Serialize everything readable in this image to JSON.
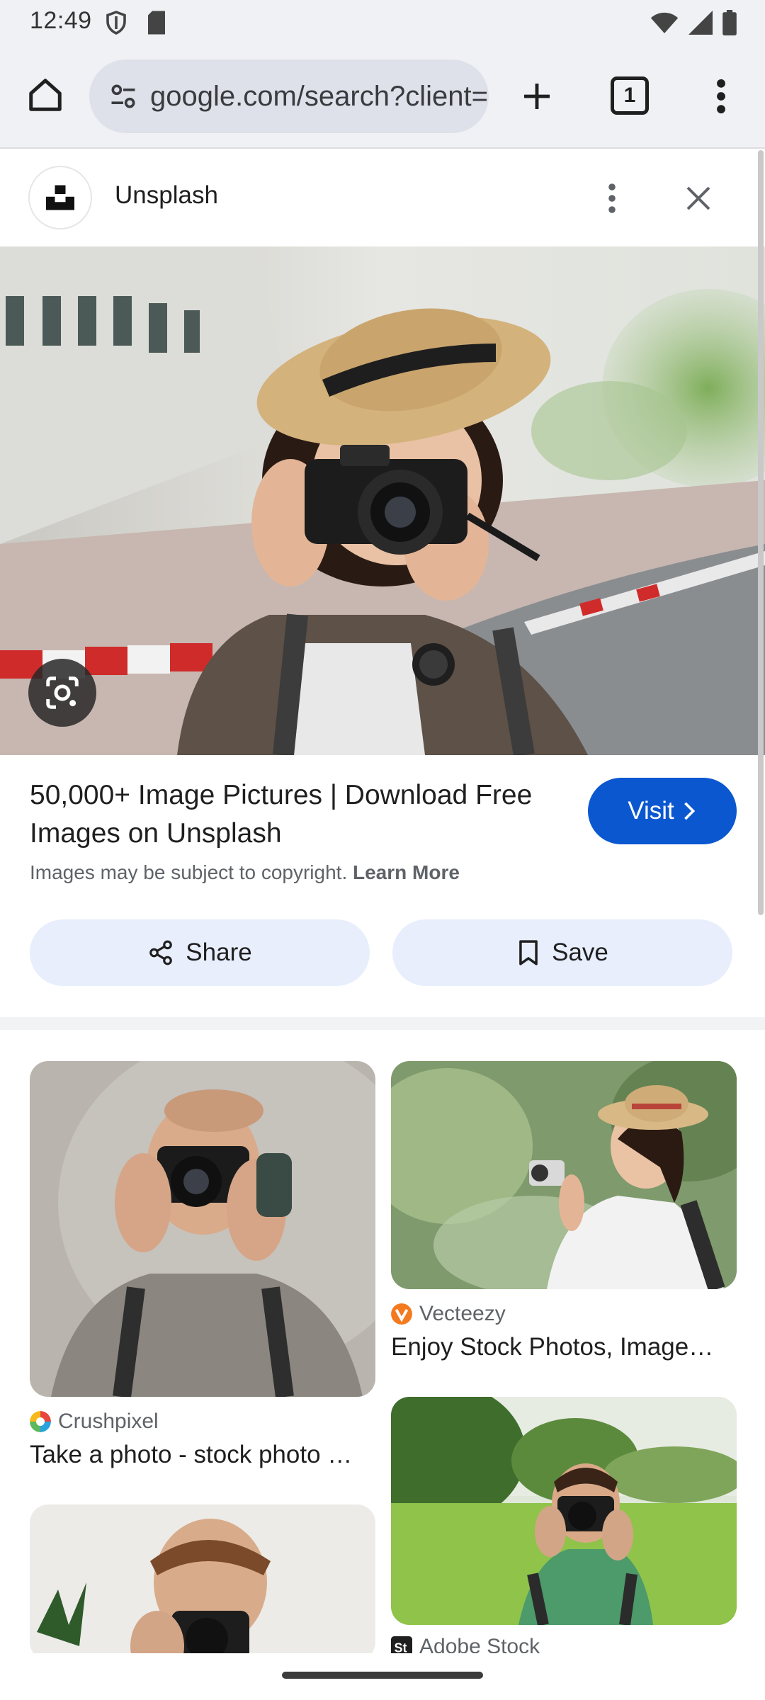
{
  "status_bar": {
    "time": "12:49"
  },
  "browser": {
    "url": "google.com/search?client=ms-android",
    "tab_count": "1"
  },
  "panel": {
    "site_name": "Unsplash"
  },
  "result": {
    "title": "50,000+ Image Pictures | Download Free Images on Unsplash",
    "visit_label": "Visit",
    "copyright_text": "Images may be subject to copyright.",
    "learn_more": "Learn More",
    "share_label": "Share",
    "save_label": "Save"
  },
  "related": [
    {
      "source": "Crushpixel",
      "caption": "Take a photo - stock photo …",
      "logo_color": "#e8453c"
    },
    {
      "source": "Vecteezy",
      "caption": "Enjoy Stock Photos, Image…",
      "logo_color": "#f47a20"
    },
    {
      "source": "Adobe Stock",
      "caption": "",
      "logo_color": "#1f1f1f"
    }
  ],
  "colors": {
    "accent": "#0b57d0",
    "pill_bg": "#e8eefb",
    "toolbar_bg": "#f0f1f5"
  }
}
